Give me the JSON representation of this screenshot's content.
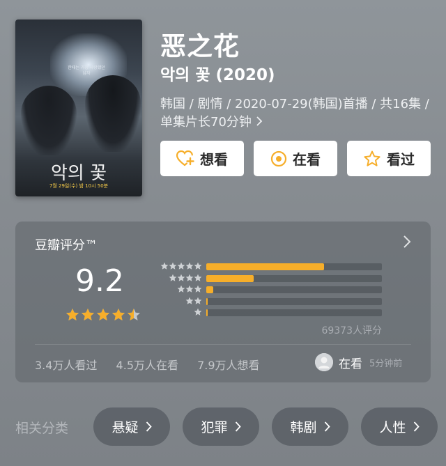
{
  "header": {
    "title": "恶之花",
    "subtitle": "악의 꽃 (2020)",
    "meta": "韩国 / 剧情 / 2020-07-29(韩国)首播 / 共16集 / 单集片长70分钟",
    "poster": {
      "title": "악의 꽃",
      "tagline": "7월 29일(수) 밤 10시 50분",
      "top_text": "한때는 가장 사랑했던 남자"
    }
  },
  "actions": {
    "want": {
      "label": "想看",
      "icon": "heart-plus-icon"
    },
    "watching": {
      "label": "在看",
      "icon": "target-icon"
    },
    "watched": {
      "label": "看过",
      "icon": "star-outline-icon"
    }
  },
  "rating": {
    "title": "豆瓣评分™",
    "score": "9.2",
    "stars": 4.5,
    "distribution": [
      {
        "stars": 5,
        "fraction": 0.67
      },
      {
        "stars": 4,
        "fraction": 0.27
      },
      {
        "stars": 3,
        "fraction": 0.04
      },
      {
        "stars": 2,
        "fraction": 0.005
      },
      {
        "stars": 1,
        "fraction": 0.005
      }
    ],
    "count": "69373人评分",
    "watched": "3.4万人看过",
    "watching": "4.5万人在看",
    "want": "7.9万人想看",
    "friend_status": "在看",
    "friend_time": "5分钟前",
    "accent_color": "#f6ae2a"
  },
  "tags": {
    "label": "相关分类",
    "items": [
      "悬疑",
      "犯罪",
      "韩剧",
      "人性"
    ]
  }
}
